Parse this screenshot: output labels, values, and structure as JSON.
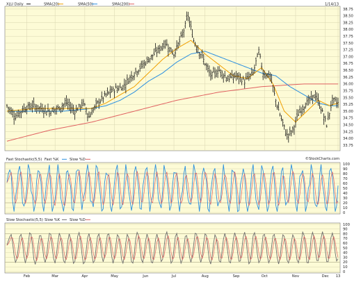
{
  "chart_data": [
    {
      "type": "ohlc",
      "panel": "price",
      "symbol_label": "XLU Daily",
      "date_label": "1/14/13",
      "legend": [
        {
          "name": "SMA(20)",
          "color": "#f0a000"
        },
        {
          "name": "SMA(50)",
          "color": "#2a8fe0"
        },
        {
          "name": "SMA(200)",
          "color": "#e06060"
        }
      ],
      "watermark": "©StockCharts.com",
      "ylim": [
        33.6,
        38.8
      ],
      "y_ticks": [
        33.75,
        34.0,
        34.25,
        34.5,
        34.75,
        35.0,
        35.25,
        35.5,
        35.75,
        36.0,
        36.25,
        36.5,
        36.75,
        37.0,
        37.25,
        37.5,
        37.75,
        38.0,
        38.25,
        38.5,
        38.75
      ],
      "y_tick_labels": [
        "33.75",
        "34.00",
        "34.25",
        "34.50",
        "34.75",
        "35.00",
        "35.25",
        "35.50",
        "35.75",
        "36.00",
        "36.25",
        "36.50",
        "36.75",
        "37.00",
        "37.25",
        "37.50",
        "37.75",
        "38.00",
        "38.25",
        "38.50",
        "38.75"
      ],
      "grid": true,
      "price_keypoints": [
        [
          0,
          35.2
        ],
        [
          6,
          34.8
        ],
        [
          12,
          35.1
        ],
        [
          18,
          35.2
        ],
        [
          24,
          35.1
        ],
        [
          30,
          35.0
        ],
        [
          36,
          35.1
        ],
        [
          42,
          35.3
        ],
        [
          48,
          35.0
        ],
        [
          54,
          35.3
        ],
        [
          58,
          34.8
        ],
        [
          64,
          35.3
        ],
        [
          70,
          35.6
        ],
        [
          76,
          35.8
        ],
        [
          82,
          35.9
        ],
        [
          88,
          36.3
        ],
        [
          94,
          36.6
        ],
        [
          100,
          36.9
        ],
        [
          106,
          37.2
        ],
        [
          112,
          37.5
        ],
        [
          118,
          37.1
        ],
        [
          124,
          37.8
        ],
        [
          128,
          38.5
        ],
        [
          132,
          37.6
        ],
        [
          138,
          37.0
        ],
        [
          144,
          36.3
        ],
        [
          150,
          36.5
        ],
        [
          156,
          36.2
        ],
        [
          162,
          36.3
        ],
        [
          168,
          36.1
        ],
        [
          174,
          36.4
        ],
        [
          178,
          37.2
        ],
        [
          181,
          36.4
        ],
        [
          186,
          36.3
        ],
        [
          190,
          35.4
        ],
        [
          194,
          34.7
        ],
        [
          198,
          34.1
        ],
        [
          202,
          34.3
        ],
        [
          206,
          34.9
        ],
        [
          210,
          35.2
        ],
        [
          214,
          35.4
        ],
        [
          218,
          35.6
        ],
        [
          222,
          35.1
        ],
        [
          226,
          34.5
        ],
        [
          230,
          35.4
        ],
        [
          234,
          35.3
        ]
      ],
      "ohlc_sample_step": 1,
      "sma20_keypoints": [
        [
          0,
          35.0
        ],
        [
          20,
          35.1
        ],
        [
          40,
          35.1
        ],
        [
          60,
          35.1
        ],
        [
          70,
          35.3
        ],
        [
          80,
          35.6
        ],
        [
          90,
          35.9
        ],
        [
          100,
          36.4
        ],
        [
          110,
          36.9
        ],
        [
          120,
          37.3
        ],
        [
          130,
          37.6
        ],
        [
          140,
          37.1
        ],
        [
          150,
          36.7
        ],
        [
          160,
          36.3
        ],
        [
          170,
          36.2
        ],
        [
          180,
          36.6
        ],
        [
          188,
          36.0
        ],
        [
          196,
          35.0
        ],
        [
          204,
          34.6
        ],
        [
          212,
          35.0
        ],
        [
          220,
          35.4
        ],
        [
          228,
          35.2
        ],
        [
          234,
          35.3
        ]
      ],
      "sma50_keypoints": [
        [
          0,
          35.0
        ],
        [
          20,
          35.0
        ],
        [
          40,
          35.0
        ],
        [
          60,
          35.1
        ],
        [
          70,
          35.2
        ],
        [
          80,
          35.4
        ],
        [
          90,
          35.7
        ],
        [
          100,
          36.1
        ],
        [
          110,
          36.4
        ],
        [
          120,
          36.8
        ],
        [
          130,
          37.1
        ],
        [
          140,
          37.2
        ],
        [
          150,
          37.0
        ],
        [
          160,
          36.8
        ],
        [
          170,
          36.6
        ],
        [
          180,
          36.4
        ],
        [
          190,
          36.3
        ],
        [
          200,
          35.9
        ],
        [
          210,
          35.6
        ],
        [
          220,
          35.3
        ],
        [
          228,
          35.2
        ],
        [
          234,
          35.2
        ]
      ],
      "sma200_keypoints": [
        [
          0,
          33.9
        ],
        [
          30,
          34.3
        ],
        [
          60,
          34.6
        ],
        [
          90,
          35.0
        ],
        [
          120,
          35.4
        ],
        [
          150,
          35.7
        ],
        [
          180,
          35.9
        ],
        [
          210,
          36.0
        ],
        [
          234,
          36.0
        ]
      ]
    },
    {
      "type": "line",
      "panel": "fast_stoch",
      "title": "Fast Stochastic(5,5)",
      "legend": [
        {
          "name": "Fast %K",
          "color": "#2a8fe0"
        },
        {
          "name": "Slow %D",
          "color": "#e06060"
        }
      ],
      "ylim": [
        0,
        100
      ],
      "y_ticks": [
        0,
        10,
        20,
        30,
        40,
        50,
        60,
        70,
        80,
        90,
        100
      ],
      "y_tick_labels": [
        "0",
        "10",
        "20",
        "30",
        "40",
        "50",
        "60",
        "70",
        "80",
        "90",
        "100"
      ],
      "highlight_levels": [
        20,
        80
      ],
      "cycles": 34,
      "amplitude_pattern": [
        95,
        10,
        85,
        5,
        92,
        20,
        80,
        8,
        96,
        15
      ]
    },
    {
      "type": "line",
      "panel": "slow_stoch",
      "title": "Slow Stochastic(5,5)",
      "legend": [
        {
          "name": "Slow %K",
          "color": "#888888"
        },
        {
          "name": "Slow %D",
          "color": "#e06060"
        }
      ],
      "ylim": [
        0,
        100
      ],
      "y_ticks": [
        0,
        10,
        20,
        30,
        40,
        50,
        60,
        70,
        80,
        90,
        100
      ],
      "y_tick_labels": [
        "0",
        "10",
        "20",
        "30",
        "40",
        "50",
        "60",
        "70",
        "80",
        "90",
        "100"
      ],
      "highlight_levels": [
        20,
        80
      ],
      "cycles": 34
    }
  ],
  "x_axis": {
    "labels": [
      "Feb",
      "Mar",
      "Apr",
      "May",
      "Jun",
      "Jul",
      "Aug",
      "Sep",
      "Oct",
      "Nov",
      "Dec",
      "13"
    ],
    "label_bar_index": [
      14,
      34,
      55,
      76,
      98,
      118,
      140,
      162,
      182,
      204,
      225,
      234
    ],
    "bar_count": 235
  },
  "colors": {
    "panel_bg": "#fdfbd6",
    "grid": "#d8d4b0",
    "bars": "#111111",
    "sma20": "#f0a000",
    "sma50": "#2a8fe0",
    "sma200": "#e06060",
    "slowk": "#6e6e6e"
  }
}
